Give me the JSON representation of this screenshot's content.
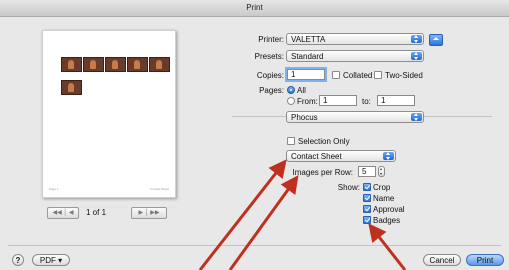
{
  "window": {
    "title": "Print"
  },
  "preview": {
    "page_indicator": "1 of 1",
    "footer_left": "Page 1",
    "footer_right": "Contact Sheet"
  },
  "printer": {
    "label": "Printer:",
    "value": "VALETTA"
  },
  "presets": {
    "label": "Presets:",
    "value": "Standard"
  },
  "copies": {
    "label": "Copies:",
    "value": "1",
    "collated_label": "Collated",
    "collated": false,
    "two_sided_label": "Two-Sided",
    "two_sided": false
  },
  "pages": {
    "label": "Pages:",
    "all_label": "All",
    "from_label": "From:",
    "from_value": "1",
    "to_label": "to:",
    "to_value": "1",
    "selected": "All"
  },
  "app_menu": {
    "value": "Phocus"
  },
  "selection_only": {
    "label": "Selection Only",
    "checked": false
  },
  "layout_menu": {
    "value": "Contact Sheet"
  },
  "images_per_row": {
    "label": "Images per Row:",
    "value": "5"
  },
  "show": {
    "label": "Show:",
    "options": [
      {
        "label": "Crop",
        "checked": true
      },
      {
        "label": "Name",
        "checked": true
      },
      {
        "label": "Approval",
        "checked": true
      },
      {
        "label": "Badges",
        "checked": true
      }
    ]
  },
  "footer": {
    "help": "?",
    "pdf": "PDF ▾",
    "cancel": "Cancel",
    "print": "Print"
  },
  "colors": {
    "annotation_arrow": "#c0301f",
    "accent": "#2f75dc"
  }
}
